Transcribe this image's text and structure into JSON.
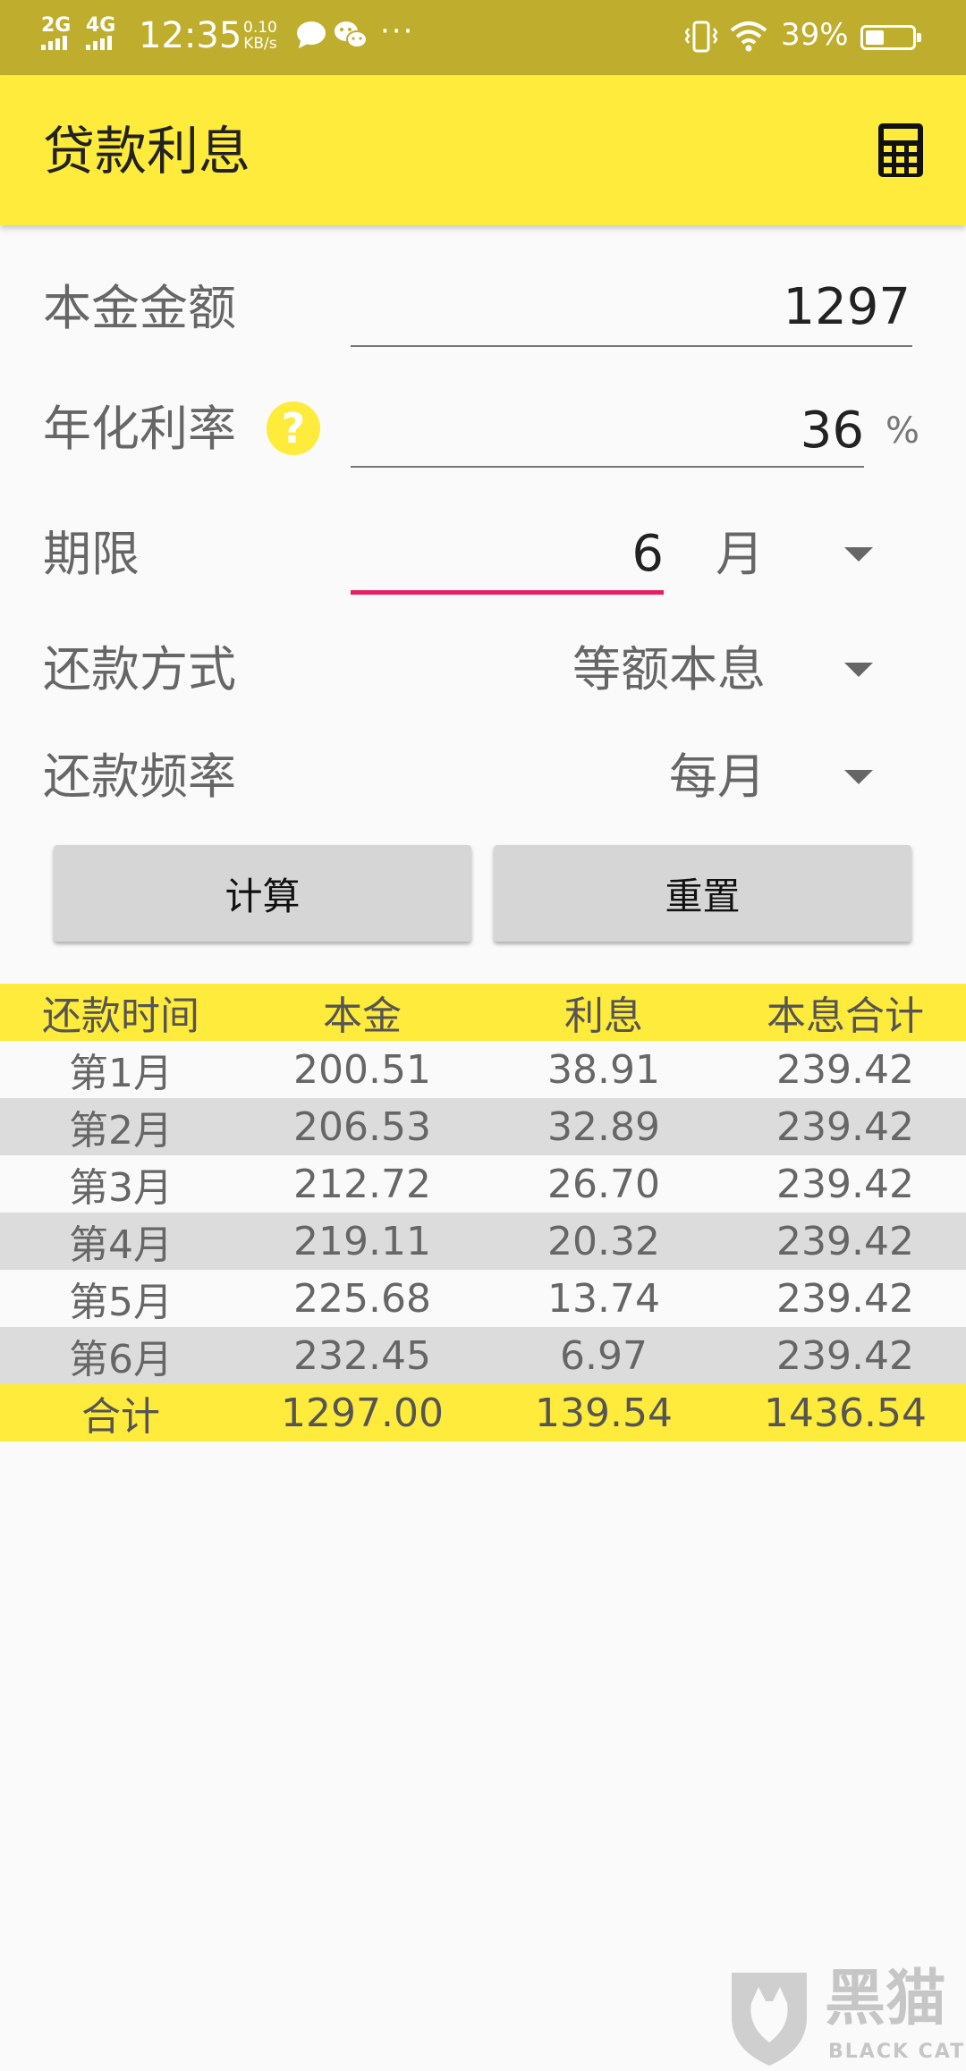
{
  "status_bar": {
    "network1": "2G",
    "network2": "4G",
    "time": "12:35",
    "speed_value": "0.10",
    "speed_unit": "KB/s",
    "more": "···",
    "battery_percent": "39%",
    "battery_level": 0.39
  },
  "app_bar": {
    "title": "贷款利息",
    "action_icon": "calculator-icon"
  },
  "form": {
    "principal": {
      "label": "本金金额",
      "value": "1297"
    },
    "rate": {
      "label": "年化利率",
      "help_glyph": "?",
      "value": "36",
      "unit": "%"
    },
    "term": {
      "label": "期限",
      "value": "6",
      "unit": "月"
    },
    "method": {
      "label": "还款方式",
      "value": "等额本息"
    },
    "frequency": {
      "label": "还款频率",
      "value": "每月"
    }
  },
  "buttons": {
    "calculate": "计算",
    "reset": "重置"
  },
  "table": {
    "headers": [
      "还款时间",
      "本金",
      "利息",
      "本息合计"
    ],
    "rows": [
      [
        "第1月",
        "200.51",
        "38.91",
        "239.42"
      ],
      [
        "第2月",
        "206.53",
        "32.89",
        "239.42"
      ],
      [
        "第3月",
        "212.72",
        "26.70",
        "239.42"
      ],
      [
        "第4月",
        "219.11",
        "20.32",
        "239.42"
      ],
      [
        "第5月",
        "225.68",
        "13.74",
        "239.42"
      ],
      [
        "第6月",
        "232.45",
        "6.97",
        "239.42"
      ]
    ],
    "total": [
      "合计",
      "1297.00",
      "139.54",
      "1436.54"
    ]
  },
  "watermark": {
    "brand_cn": "黑猫",
    "brand_en": "BLACK CAT"
  },
  "colors": {
    "accent": "#ffeb3b",
    "status_bar": "#bfae2e",
    "focus_underline": "#e91e63"
  }
}
